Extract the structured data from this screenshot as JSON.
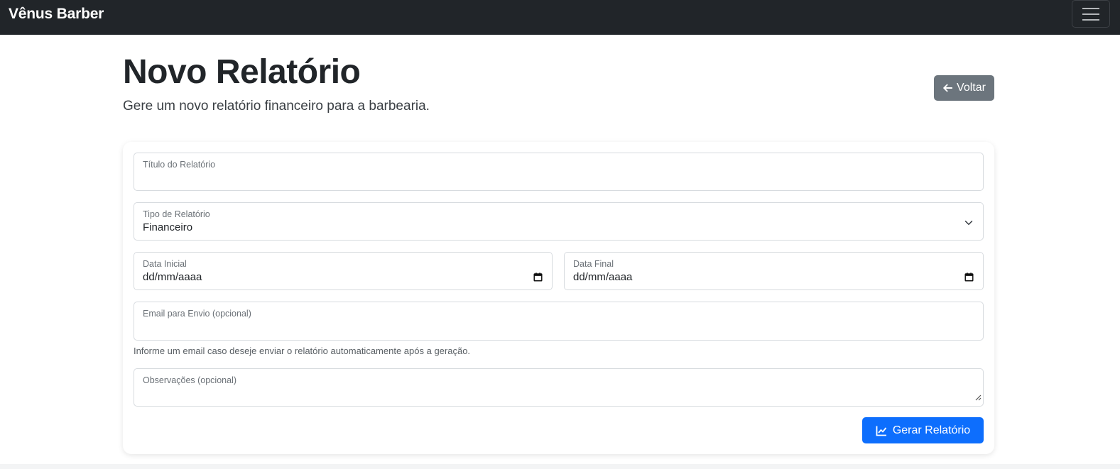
{
  "navbar": {
    "brand": "Vênus Barber",
    "toggler_icon": "hamburger-icon"
  },
  "header": {
    "title": "Novo Relatório",
    "subtitle": "Gere um novo relatório financeiro para a barbearia.",
    "back_button": {
      "label": "Voltar",
      "icon": "arrow-left-icon"
    }
  },
  "form": {
    "title_field": {
      "label": "Título do Relatório",
      "value": ""
    },
    "type_field": {
      "label": "Tipo de Relatório",
      "value": "Financeiro",
      "icon": "chevron-down-icon"
    },
    "start_date": {
      "label": "Data Inicial",
      "value": "dd/mm/aaaa",
      "icon": "calendar-icon"
    },
    "end_date": {
      "label": "Data Final",
      "value": "dd/mm/aaaa",
      "icon": "calendar-icon"
    },
    "email_field": {
      "label": "Email para Envio (opcional)",
      "value": "",
      "help": "Informe um email caso deseje enviar o relatório automaticamente após a geração."
    },
    "notes_field": {
      "label": "Observações (opcional)",
      "value": "",
      "icon": "resize-handle-icon"
    },
    "submit_button": {
      "label": "Gerar Relatório",
      "icon": "line-chart-icon"
    }
  },
  "colors": {
    "navbar": "#212529",
    "primary": "#0d6efd",
    "secondary": "#6c757d"
  }
}
